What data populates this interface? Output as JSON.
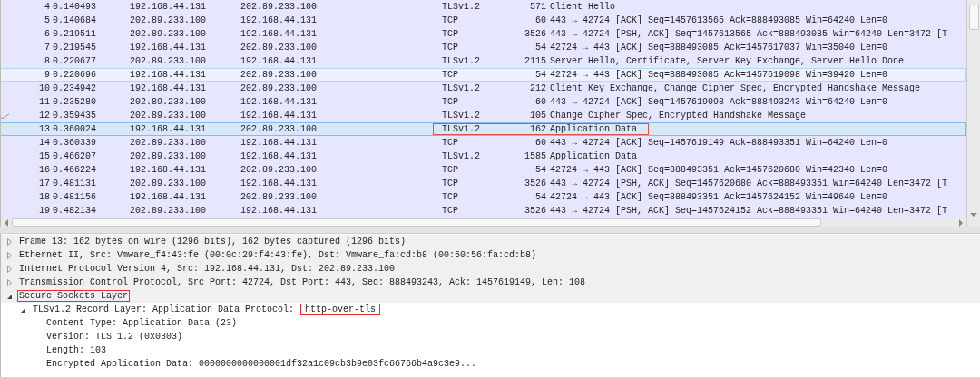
{
  "packet_list": {
    "rows": [
      {
        "no": "4",
        "time": "0.140493",
        "source": "192.168.44.131",
        "destination": "202.89.233.100",
        "protocol": "TLSv1.2",
        "length": "571",
        "info": "Client Hello",
        "selected": false,
        "hovered": false,
        "annotated": false
      },
      {
        "no": "5",
        "time": "0.140684",
        "source": "202.89.233.100",
        "destination": "192.168.44.131",
        "protocol": "TCP",
        "length": "60",
        "info": "443 → 42724 [ACK] Seq=1457613565 Ack=888493085 Win=64240 Len=0",
        "selected": false,
        "hovered": false,
        "annotated": false
      },
      {
        "no": "6",
        "time": "0.219511",
        "source": "202.89.233.100",
        "destination": "192.168.44.131",
        "protocol": "TCP",
        "length": "3526",
        "info": "443 → 42724 [PSH, ACK] Seq=1457613565 Ack=888493085 Win=64240 Len=3472 [T",
        "selected": false,
        "hovered": false,
        "annotated": false
      },
      {
        "no": "7",
        "time": "0.219545",
        "source": "192.168.44.131",
        "destination": "202.89.233.100",
        "protocol": "TCP",
        "length": "54",
        "info": "42724 → 443 [ACK] Seq=888493085 Ack=1457617037 Win=35040 Len=0",
        "selected": false,
        "hovered": false,
        "annotated": false
      },
      {
        "no": "8",
        "time": "0.220677",
        "source": "202.89.233.100",
        "destination": "192.168.44.131",
        "protocol": "TLSv1.2",
        "length": "2115",
        "info": "Server Hello, Certificate, Server Key Exchange, Server Hello Done",
        "selected": false,
        "hovered": false,
        "annotated": false
      },
      {
        "no": "9",
        "time": "0.220696",
        "source": "192.168.44.131",
        "destination": "202.89.233.100",
        "protocol": "TCP",
        "length": "54",
        "info": "42724 → 443 [ACK] Seq=888493085 Ack=1457619098 Win=39420 Len=0",
        "selected": false,
        "hovered": true,
        "annotated": false
      },
      {
        "no": "10",
        "time": "0.234942",
        "source": "192.168.44.131",
        "destination": "202.89.233.100",
        "protocol": "TLSv1.2",
        "length": "212",
        "info": "Client Key Exchange, Change Cipher Spec, Encrypted Handshake Message",
        "selected": false,
        "hovered": false,
        "annotated": false
      },
      {
        "no": "11",
        "time": "0.235280",
        "source": "202.89.233.100",
        "destination": "192.168.44.131",
        "protocol": "TCP",
        "length": "60",
        "info": "443 → 42724 [ACK] Seq=1457619098 Ack=888493243 Win=64240 Len=0",
        "selected": false,
        "hovered": false,
        "annotated": false
      },
      {
        "no": "12",
        "time": "0.359435",
        "source": "202.89.233.100",
        "destination": "192.168.44.131",
        "protocol": "TLSv1.2",
        "length": "105",
        "info": "Change Cipher Spec, Encrypted Handshake Message",
        "selected": false,
        "hovered": false,
        "annotated": false,
        "related": true
      },
      {
        "no": "13",
        "time": "0.360024",
        "source": "192.168.44.131",
        "destination": "202.89.233.100",
        "protocol": "TLSv1.2",
        "length": "162",
        "info": "Application Data",
        "selected": true,
        "hovered": false,
        "annotated": true
      },
      {
        "no": "14",
        "time": "0.360339",
        "source": "202.89.233.100",
        "destination": "192.168.44.131",
        "protocol": "TCP",
        "length": "60",
        "info": "443 → 42724 [ACK] Seq=1457619149 Ack=888493351 Win=64240 Len=0",
        "selected": false,
        "hovered": false,
        "annotated": false
      },
      {
        "no": "15",
        "time": "0.466207",
        "source": "202.89.233.100",
        "destination": "192.168.44.131",
        "protocol": "TLSv1.2",
        "length": "1585",
        "info": "Application Data",
        "selected": false,
        "hovered": false,
        "annotated": false
      },
      {
        "no": "16",
        "time": "0.466224",
        "source": "192.168.44.131",
        "destination": "202.89.233.100",
        "protocol": "TCP",
        "length": "54",
        "info": "42724 → 443 [ACK] Seq=888493351 Ack=1457620680 Win=42340 Len=0",
        "selected": false,
        "hovered": false,
        "annotated": false
      },
      {
        "no": "17",
        "time": "0.481131",
        "source": "202.89.233.100",
        "destination": "192.168.44.131",
        "protocol": "TCP",
        "length": "3526",
        "info": "443 → 42724 [PSH, ACK] Seq=1457620680 Ack=888493351 Win=64240 Len=3472 [T",
        "selected": false,
        "hovered": false,
        "annotated": false
      },
      {
        "no": "18",
        "time": "0.481156",
        "source": "192.168.44.131",
        "destination": "202.89.233.100",
        "protocol": "TCP",
        "length": "54",
        "info": "42724 → 443 [ACK] Seq=888493351 Ack=1457624152 Win=49640 Len=0",
        "selected": false,
        "hovered": false,
        "annotated": false
      },
      {
        "no": "19",
        "time": "0.482134",
        "source": "202.89.233.100",
        "destination": "192.168.44.131",
        "protocol": "TCP",
        "length": "3526",
        "info": "443 → 42724 [PSH, ACK] Seq=1457624152 Ack=888493351 Win=64240 Len=3472 [T",
        "selected": false,
        "hovered": false,
        "annotated": false
      }
    ]
  },
  "packet_details": {
    "items": [
      {
        "label": "Frame 13: 162 bytes on wire (1296 bits), 162 bytes captured (1296 bits)",
        "expanded": false,
        "annotated": false
      },
      {
        "label": "Ethernet II, Src: Vmware_f4:43:fe (00:0c:29:f4:43:fe), Dst: Vmware_fa:cd:b8 (00:50:56:fa:cd:b8)",
        "expanded": false,
        "annotated": false
      },
      {
        "label": "Internet Protocol Version 4, Src: 192.168.44.131, Dst: 202.89.233.100",
        "expanded": false,
        "annotated": false
      },
      {
        "label": "Transmission Control Protocol, Src Port: 42724, Dst Port: 443, Seq: 888493243, Ack: 1457619149, Len: 108",
        "expanded": false,
        "annotated": false
      },
      {
        "label": "Secure Sockets Layer",
        "expanded": true,
        "annotated": true,
        "children": [
          {
            "label": "TLSv1.2 Record Layer: Application Data Protocol:",
            "value": "http-over-tls",
            "expanded": true,
            "annotated": true,
            "children": [
              {
                "label": "Content Type: Application Data (23)",
                "annotated": false
              },
              {
                "label": "Version: TLS 1.2 (0x0303)",
                "annotated": false
              },
              {
                "label": "Length: 103",
                "annotated": false
              },
              {
                "label": "Encrypted Application Data: 0000000000000001df32a1c09cb3b9e03fc66766b4a9c3e9...",
                "annotated": false
              }
            ]
          }
        ]
      }
    ]
  }
}
